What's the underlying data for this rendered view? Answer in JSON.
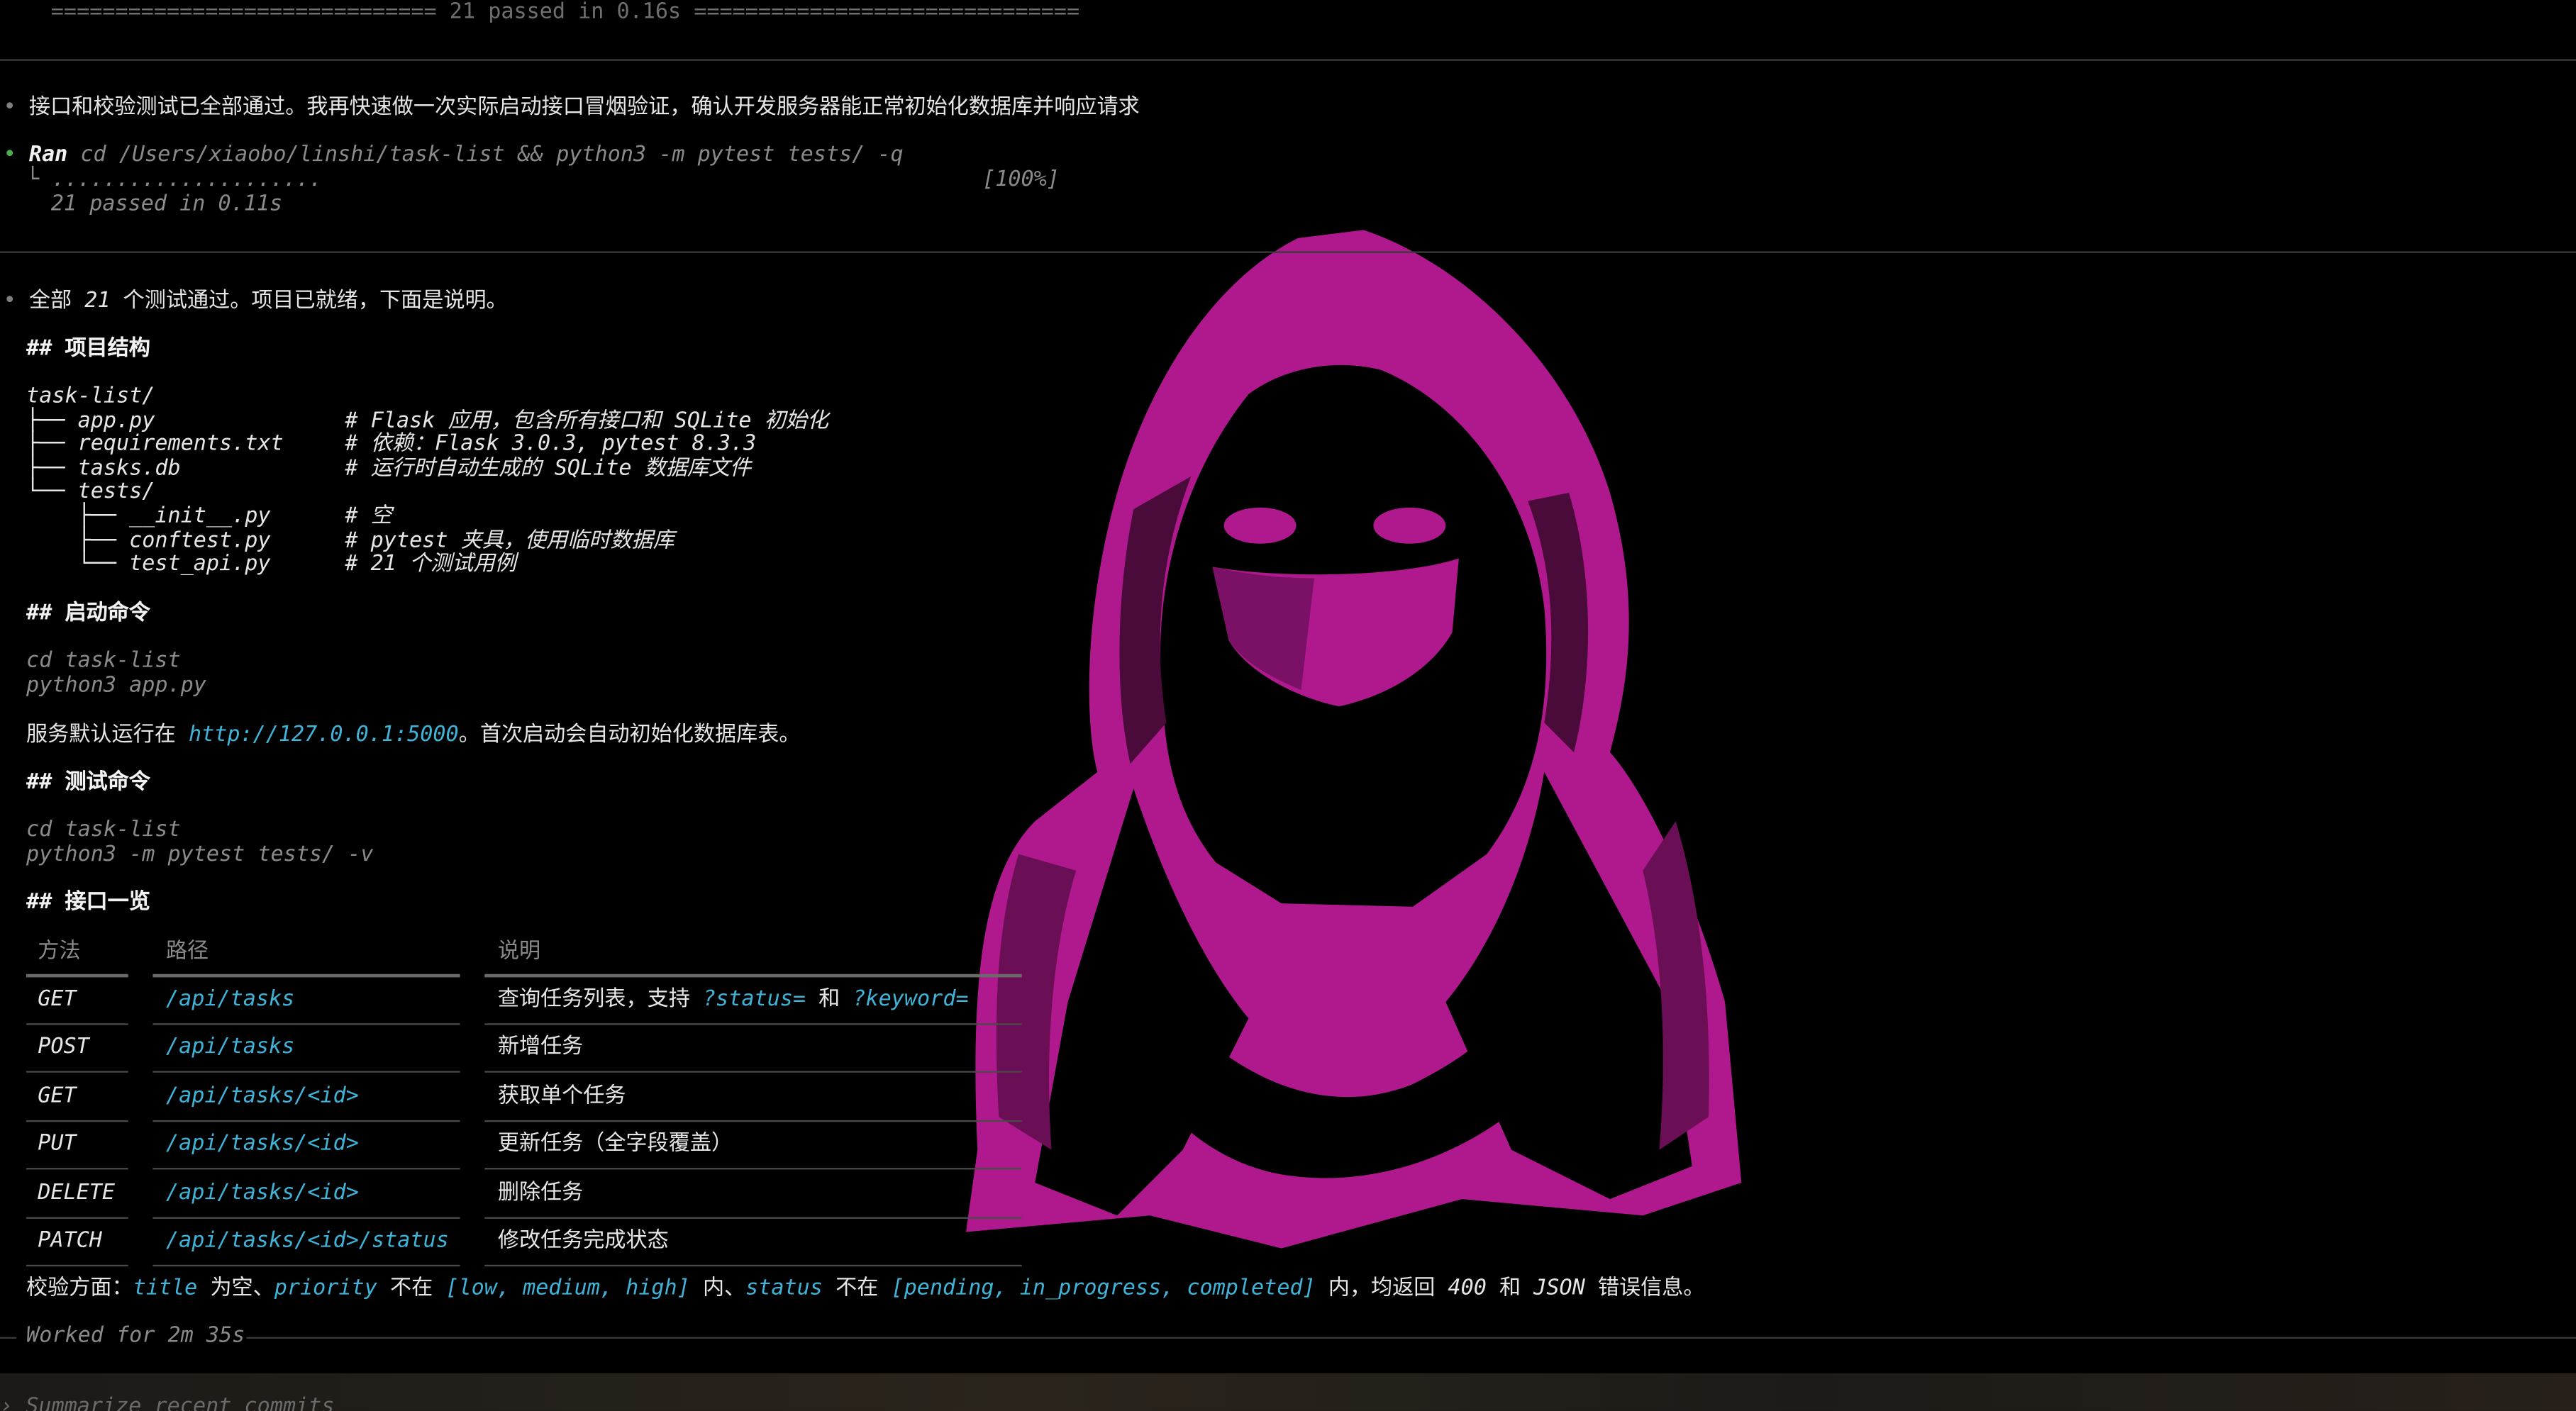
{
  "top_rule_text": "============================== 21 passed in 0.16s ==============================",
  "msg1": "接口和校验测试已全部通过。我再快速做一次实际启动接口冒烟验证，确认开发服务器能正常初始化数据库并响应请求",
  "ran": {
    "label": "Ran",
    "command": "cd /Users/xiaobo/linshi/task-list && python3 -m pytest tests/ -q",
    "dots": ".....................",
    "percent": "[100%]",
    "result": "21 passed in 0.11s"
  },
  "msg2": {
    "prefix": "全部 ",
    "count": "21",
    "suffix": " 个测试通过。项目已就绪，下面是说明。"
  },
  "sections": {
    "structure": "## 项目结构",
    "start": "## 启动命令",
    "test": "## 测试命令",
    "api": "## 接口一览"
  },
  "tree": [
    {
      "prefix": "task-list/",
      "comment": ""
    },
    {
      "prefix": "├── app.py",
      "comment": "# Flask 应用，包含所有接口和 SQLite 初始化"
    },
    {
      "prefix": "├── requirements.txt",
      "comment": "# 依赖：Flask 3.0.3, pytest 8.3.3"
    },
    {
      "prefix": "├── tasks.db",
      "comment": "# 运行时自动生成的 SQLite 数据库文件"
    },
    {
      "prefix": "└── tests/",
      "comment": ""
    },
    {
      "prefix": "    ├── __init__.py",
      "comment": "# 空"
    },
    {
      "prefix": "    ├── conftest.py",
      "comment": "# pytest 夹具，使用临时数据库"
    },
    {
      "prefix": "    └── test_api.py",
      "comment": "# 21 个测试用例"
    }
  ],
  "start_cmds": [
    "cd task-list",
    "python3 app.py"
  ],
  "serve_text": {
    "prefix": "服务默认运行在 ",
    "url": "http://127.0.0.1:5000",
    "suffix": "。首次启动会自动初始化数据库表。"
  },
  "test_cmds": [
    "cd task-list",
    "python3 -m pytest tests/ -v"
  ],
  "table": {
    "headers": [
      "方法",
      "路径",
      "说明"
    ],
    "rows": [
      {
        "method": "GET",
        "path": "/api/tasks",
        "desc": "查询任务列表，支持 ",
        "extra1": "?status=",
        "mid": " 和 ",
        "extra2": "?keyword="
      },
      {
        "method": "POST",
        "path": "/api/tasks",
        "desc": "新增任务",
        "extra1": "",
        "mid": "",
        "extra2": ""
      },
      {
        "method": "GET",
        "path": "/api/tasks/<id>",
        "desc": "获取单个任务",
        "extra1": "",
        "mid": "",
        "extra2": ""
      },
      {
        "method": "PUT",
        "path": "/api/tasks/<id>",
        "desc": "更新任务（全字段覆盖）",
        "extra1": "",
        "mid": "",
        "extra2": ""
      },
      {
        "method": "DELETE",
        "path": "/api/tasks/<id>",
        "desc": "删除任务",
        "extra1": "",
        "mid": "",
        "extra2": ""
      },
      {
        "method": "PATCH",
        "path": "/api/tasks/<id>/status",
        "desc": "修改任务完成状态",
        "extra1": "",
        "mid": "",
        "extra2": ""
      }
    ]
  },
  "validation": {
    "p1": "校验方面：",
    "c1": "title",
    "p2": " 为空、",
    "c2": "priority",
    "p3": " 不在 ",
    "c3": "[low, medium, high]",
    "p4": " 内、",
    "c4": "status",
    "p5": " 不在 ",
    "c5": "[pending, in_progress, completed]",
    "p6": " 内，均返回 ",
    "c6": "400",
    "p7": " 和 ",
    "c7": "JSON",
    "p8": " 错误信息。"
  },
  "worked": "Worked for 2m 35s",
  "prompt_placeholder": "Summarize recent commits",
  "colors": {
    "accent_cyan": "#3fb3d8",
    "hood_magenta": "#b0198e",
    "ok_green": "#4caf50"
  },
  "icons": {
    "bullet": "bullet-dot-icon",
    "tree_corner": "tree-corner-icon"
  }
}
